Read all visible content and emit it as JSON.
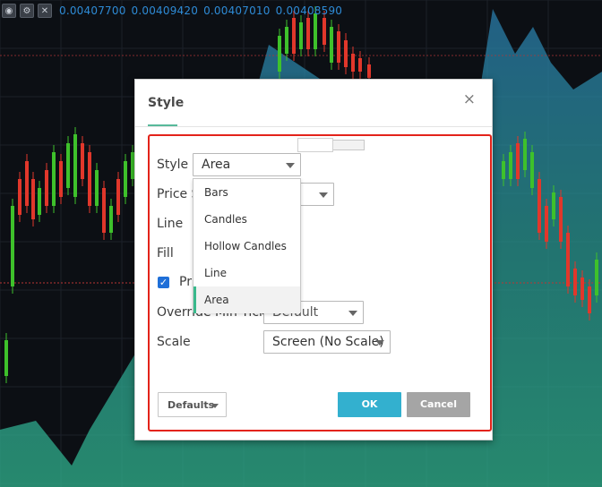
{
  "chart": {
    "toolbar_icons": [
      "eye-icon",
      "gear-icon",
      "close-icon"
    ],
    "ohlc_values": [
      "0.00407700",
      "0.00409420",
      "0.00407010",
      "0.00408590"
    ]
  },
  "dialog": {
    "title": "Style",
    "close_glyph": "×",
    "rows": {
      "style_label": "Style",
      "price_source_label": "Price S",
      "line_label": "Line",
      "fill_label": "Fill",
      "checkbox_label": "Pr",
      "override_label": "Override Min Tick",
      "scale_label": "Scale"
    },
    "style_select": {
      "value": "Area"
    },
    "override_select": {
      "value": "Default"
    },
    "scale_select": {
      "value": "Screen (No Scale)"
    },
    "dropdown_options": [
      "Bars",
      "Candles",
      "Hollow Candles",
      "Line",
      "Area"
    ],
    "selected_option": "Area",
    "buttons": {
      "defaults": "Defaults",
      "ok": "OK",
      "cancel": "Cancel"
    }
  },
  "colors": {
    "highlight_border": "#e3231a",
    "ok_button": "#33b0cf",
    "cancel_button": "#a5a5a5",
    "candle_up": "#3ec12b",
    "candle_down": "#e1372b",
    "area_fill": "#2c8a8f"
  }
}
